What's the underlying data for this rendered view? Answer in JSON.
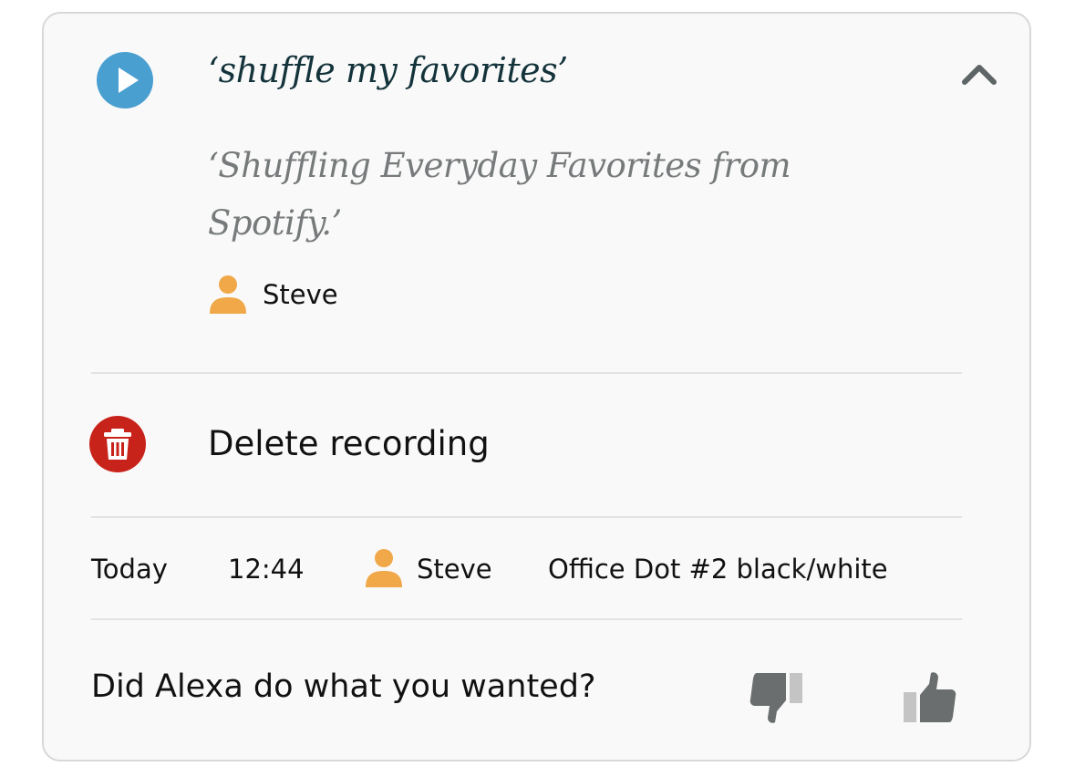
{
  "card": {
    "utterance": "‘shuffle my favorites’",
    "response": "‘Shuffling Everyday Favorites from Spotify.’",
    "speaker": "Steve",
    "icons": {
      "play": "play-icon",
      "collapse": "chevron-up-icon",
      "person": "person-icon",
      "delete": "trash-icon",
      "thumbs_down": "thumbs-down-icon",
      "thumbs_up": "thumbs-up-icon"
    }
  },
  "actions": {
    "delete_label": "Delete recording"
  },
  "meta": {
    "date": "Today",
    "time": "12:44",
    "speaker": "Steve",
    "device": "Office Dot #2 black/white"
  },
  "feedback": {
    "question": "Did Alexa do what you wanted?"
  },
  "colors": {
    "play": "#4a9fd1",
    "delete": "#c8231a",
    "person": "#f0a848",
    "thumb": "#6a6e6f"
  }
}
